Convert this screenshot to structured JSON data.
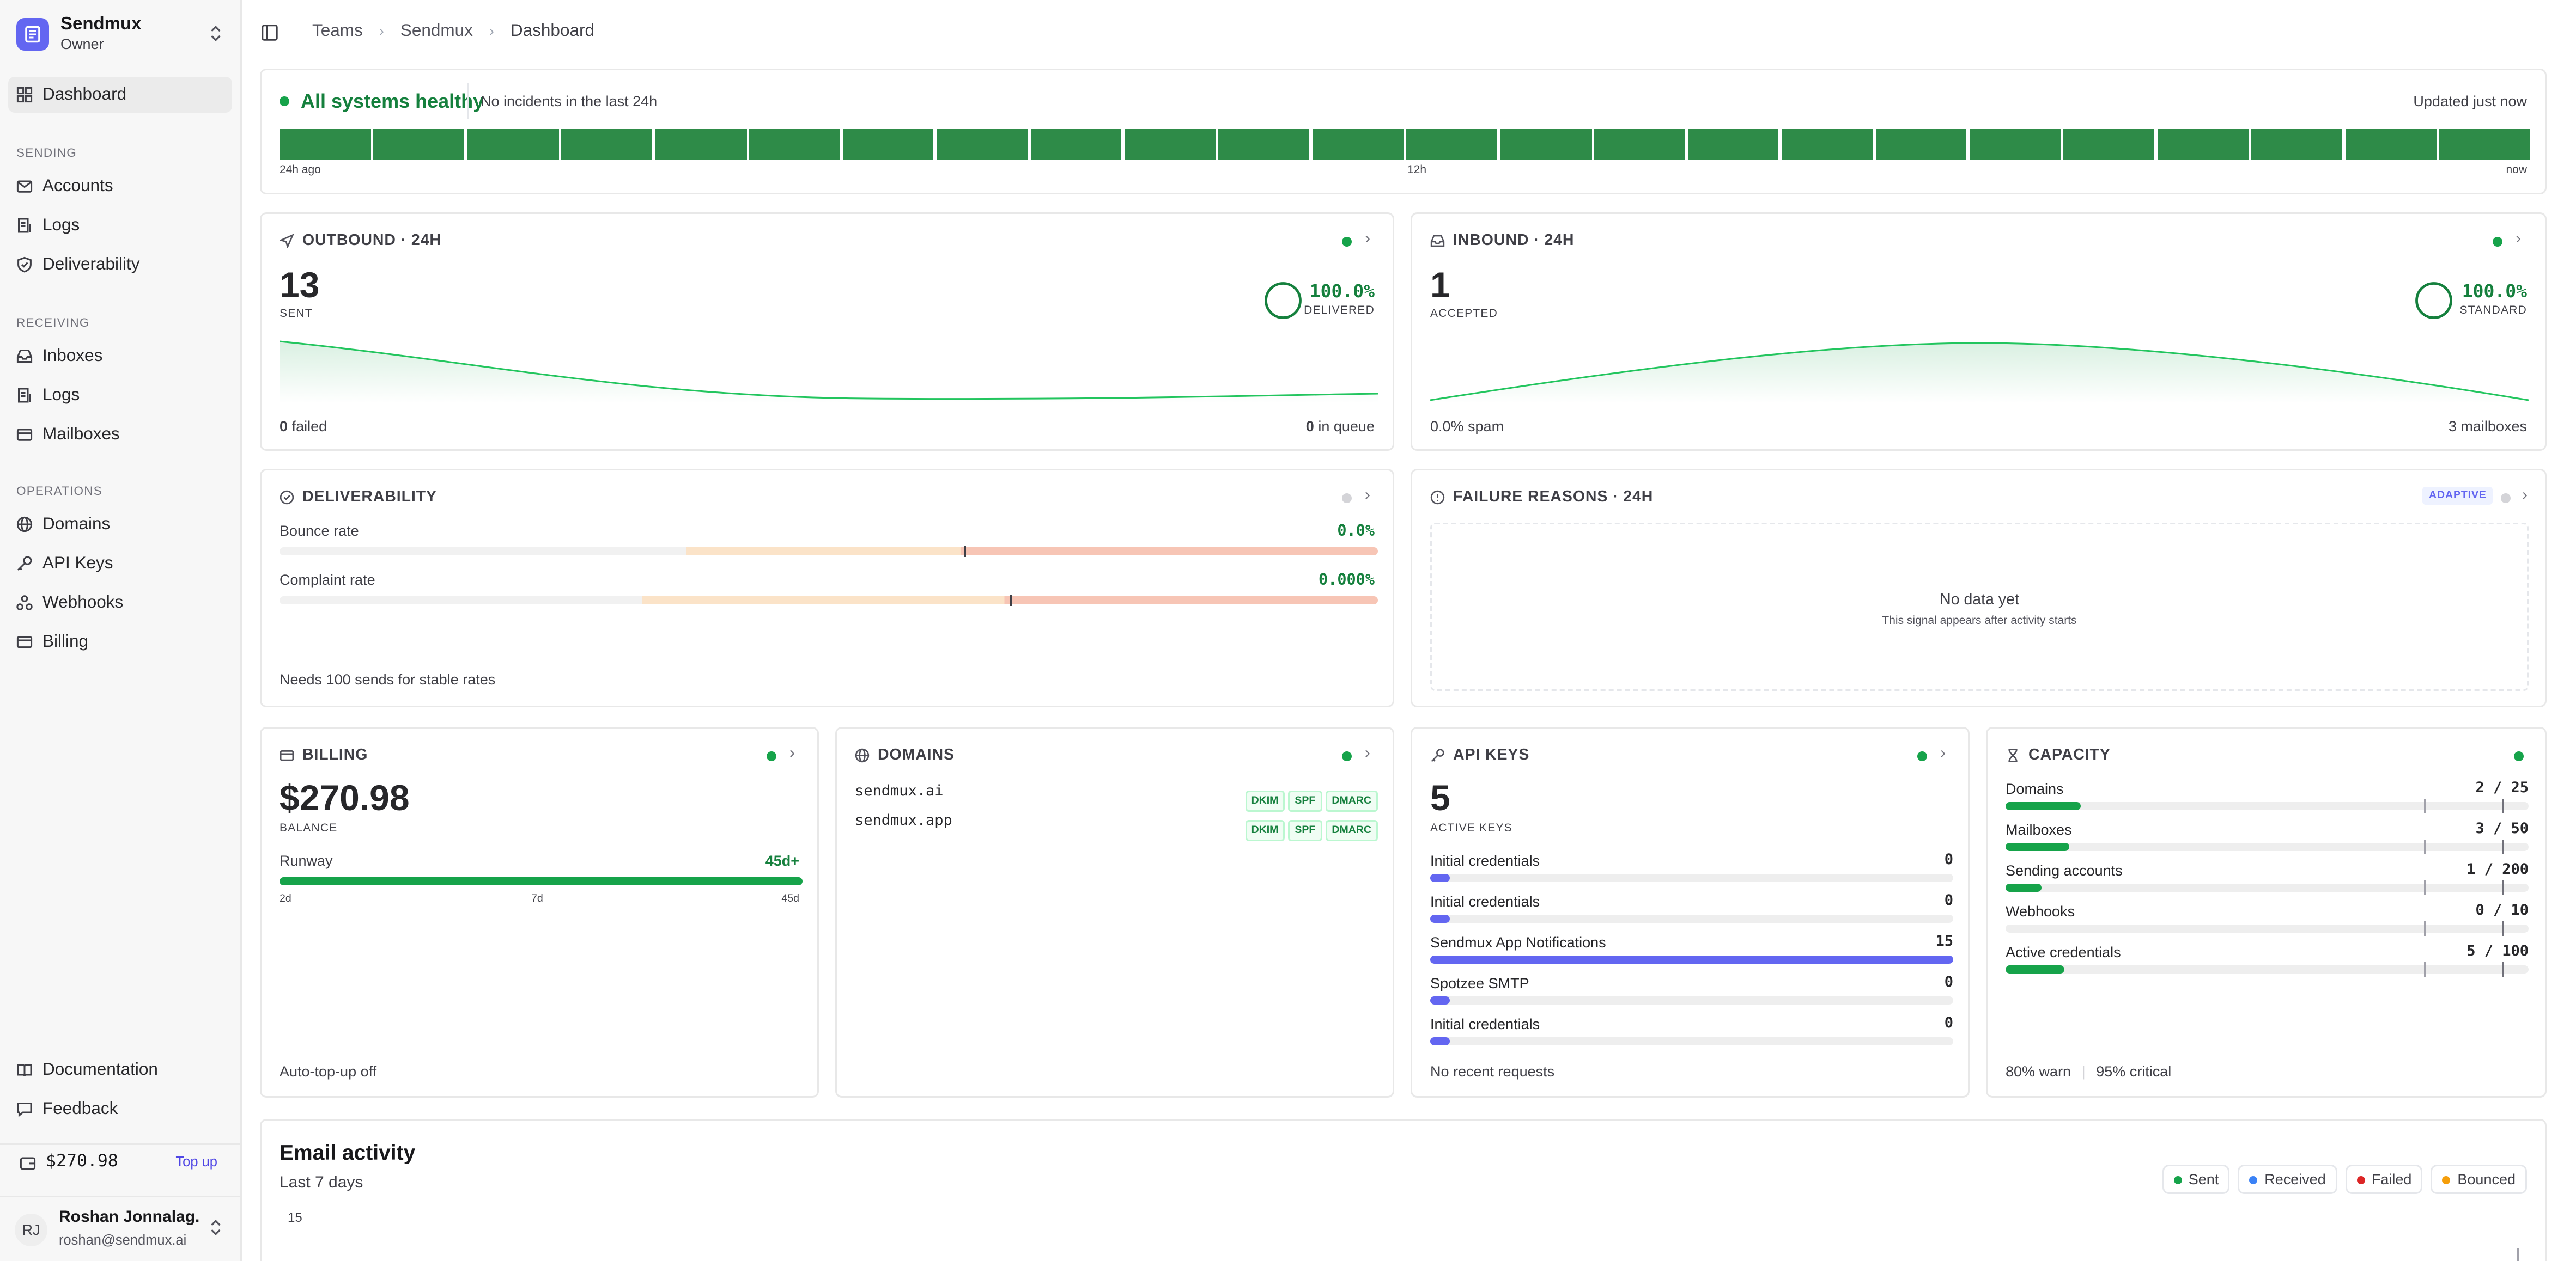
{
  "team": {
    "name": "Sendmux",
    "role": "Owner"
  },
  "nav": {
    "dashboard": "Dashboard",
    "sections": {
      "sending": "SENDING",
      "receiving": "RECEIVING",
      "operations": "OPERATIONS"
    },
    "sending": [
      "Accounts",
      "Logs",
      "Deliverability"
    ],
    "receiving": [
      "Inboxes",
      "Logs",
      "Mailboxes"
    ],
    "operations": [
      "Domains",
      "API Keys",
      "Webhooks",
      "Billing"
    ],
    "documentation": "Documentation",
    "feedback": "Feedback"
  },
  "sidebar_balance": {
    "amount": "$270.98",
    "topup": "Top up"
  },
  "user": {
    "initials": "RJ",
    "name": "Roshan Jonnalag...",
    "email": "roshan@sendmux.ai"
  },
  "breadcrumb": [
    "Teams",
    "Sendmux",
    "Dashboard"
  ],
  "health": {
    "title": "All systems healthy",
    "subtitle": "No incidents in the last 24h",
    "updated": "Updated just now",
    "bars": 24,
    "axis": {
      "left": "24h ago",
      "mid": "12h",
      "right": "now"
    }
  },
  "outbound": {
    "title": "OUTBOUND · 24H",
    "count": "13",
    "count_label": "SENT",
    "pct": "100.0%",
    "pct_label": "DELIVERED",
    "failed_num": "0",
    "failed_label": "failed",
    "queue_num": "0",
    "queue_label": "in queue"
  },
  "inbound": {
    "title": "INBOUND · 24H",
    "count": "1",
    "count_label": "ACCEPTED",
    "pct": "100.0%",
    "pct_label": "STANDARD",
    "spam": "0.0% spam",
    "mailboxes": "3 mailboxes"
  },
  "deliverability": {
    "title": "DELIVERABILITY",
    "bounce_label": "Bounce rate",
    "bounce_value": "0.0%",
    "complaint_label": "Complaint rate",
    "complaint_value": "0.000%",
    "note": "Needs 100 sends for stable rates"
  },
  "failures": {
    "title": "FAILURE REASONS · 24H",
    "badge": "ADAPTIVE",
    "empty_title": "No data yet",
    "empty_sub": "This signal appears after activity starts"
  },
  "billing": {
    "title": "BILLING",
    "balance": "$270.98",
    "balance_label": "BALANCE",
    "runway_label": "Runway",
    "runway_value": "45d+",
    "ticks": [
      "2d",
      "7d",
      "45d"
    ],
    "runway_fraction": 1.0,
    "auto_topup": "Auto-top-up off"
  },
  "domains": {
    "title": "DOMAINS",
    "items": [
      {
        "name": "sendmux.ai",
        "badges": [
          "DKIM",
          "SPF",
          "DMARC"
        ]
      },
      {
        "name": "sendmux.app",
        "badges": [
          "DKIM",
          "SPF",
          "DMARC"
        ]
      }
    ]
  },
  "api_keys": {
    "title": "API KEYS",
    "count": "5",
    "count_label": "ACTIVE KEYS",
    "items": [
      {
        "name": "Initial credentials",
        "value": "0"
      },
      {
        "name": "Initial credentials",
        "value": "0"
      },
      {
        "name": "Sendmux App Notifications",
        "value": "15"
      },
      {
        "name": "Spotzee SMTP",
        "value": "0"
      },
      {
        "name": "Initial credentials",
        "value": "0"
      }
    ],
    "footer": "No recent requests"
  },
  "capacity": {
    "title": "CAPACITY",
    "items": [
      {
        "name": "Domains",
        "value": "2 / 25",
        "used": 2,
        "limit": 25
      },
      {
        "name": "Mailboxes",
        "value": "3 / 50",
        "used": 3,
        "limit": 50
      },
      {
        "name": "Sending accounts",
        "value": "1 / 200",
        "used": 1,
        "limit": 200
      },
      {
        "name": "Webhooks",
        "value": "0 / 10",
        "used": 0,
        "limit": 10
      },
      {
        "name": "Active credentials",
        "value": "5 / 100",
        "used": 5,
        "limit": 100
      }
    ],
    "warn": "80% warn",
    "critical": "95% critical"
  },
  "activity": {
    "title": "Email activity",
    "subtitle": "Last 7 days",
    "y_top": "15",
    "legend": [
      {
        "label": "Sent",
        "color": "#16a34a"
      },
      {
        "label": "Received",
        "color": "#3b82f6"
      },
      {
        "label": "Failed",
        "color": "#dc2626"
      },
      {
        "label": "Bounced",
        "color": "#f59e0b"
      }
    ]
  },
  "colors": {
    "green": "#16a34a",
    "indigo": "#6366f1",
    "bar_green": "#2e8b48"
  }
}
